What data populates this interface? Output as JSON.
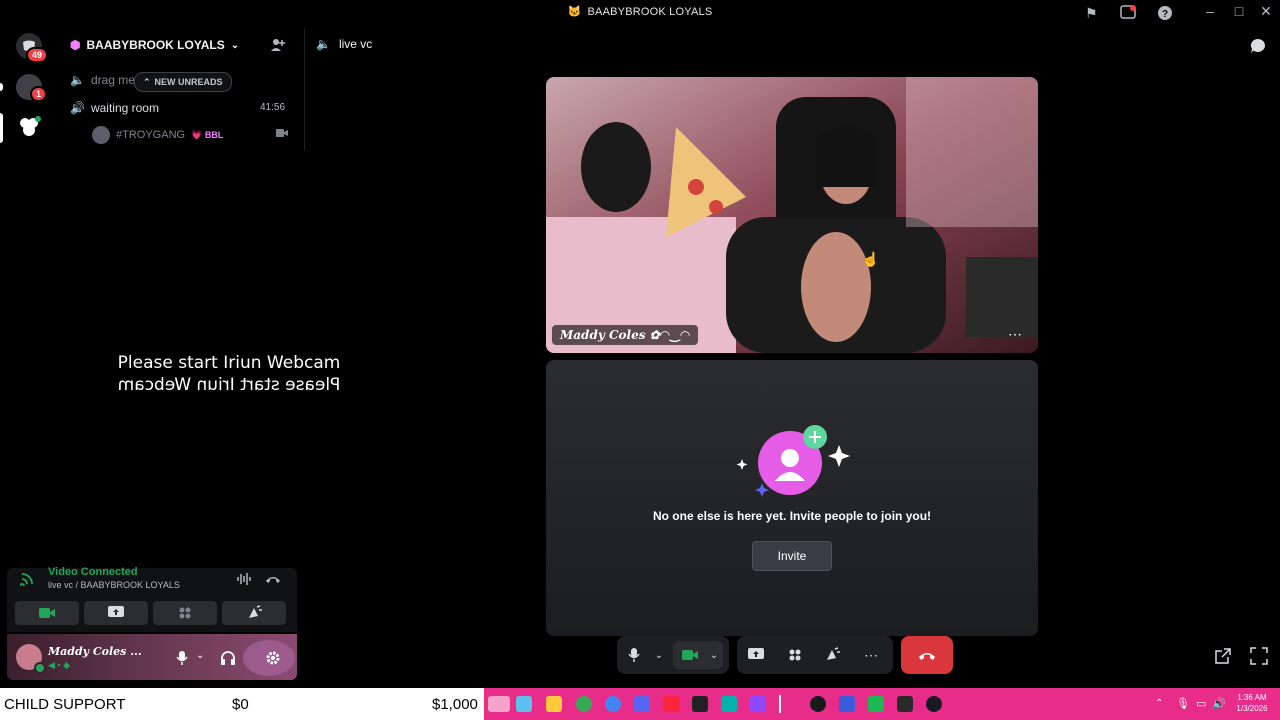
{
  "window": {
    "title": "BAABYBROOK LOYALS"
  },
  "rail": {
    "dm_badge": "49",
    "user_badge": "1"
  },
  "server": {
    "name": "BAABYBROOK LOYALS"
  },
  "channels": {
    "drag_partial": "drag me",
    "new_unreads": "NEW UNREADS",
    "waiting_room": "waiting room",
    "waiting_time": "41:56",
    "member_name": "#TROYGANG",
    "member_tag": "BBL"
  },
  "voice_header": {
    "channel": "live vc"
  },
  "iriun": {
    "message": "Please start Iriun Webcam"
  },
  "video": {
    "participant_name": "Maddy Coles ✿◠‿◠"
  },
  "empty_state": {
    "message": "No one else is here yet. Invite people to join you!",
    "invite_label": "Invite"
  },
  "voice_status": {
    "status": "Video Connected",
    "path": "live vc / BAABYBROOK LOYALS"
  },
  "user_panel": {
    "name": "Maddy Coles ..."
  },
  "ticker": {
    "label": "CHILD SUPPORT",
    "value1": "$0",
    "value2": "$1,000"
  },
  "clock": {
    "time": "1:36 AM",
    "date": "1/3/2026"
  },
  "colors": {
    "accent_green": "#23a55a",
    "danger": "#da373c",
    "taskbar": "#e72c8a"
  }
}
